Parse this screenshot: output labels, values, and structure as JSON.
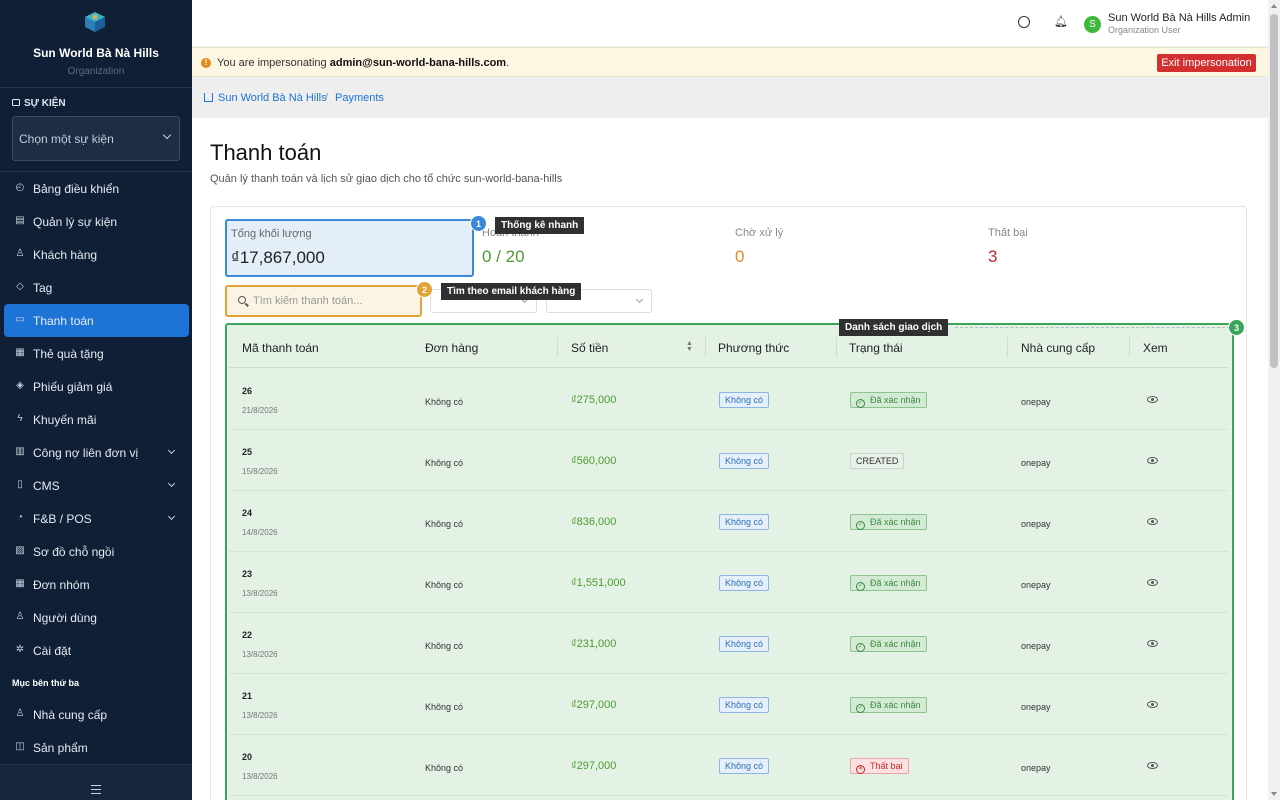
{
  "sidebar": {
    "brand_name": "Sun World Bà Nà Hills",
    "brand_sub": "Organization",
    "events_heading": "SỰ KIỆN",
    "event_select_placeholder": "Chọn một sự kiện",
    "items": [
      {
        "label": "Bảng điều khiển",
        "icon": "dashboard-icon"
      },
      {
        "label": "Quản lý sự kiện",
        "icon": "calendar-icon"
      },
      {
        "label": "Khách hàng",
        "icon": "users-icon"
      },
      {
        "label": "Tag",
        "icon": "tag-icon"
      },
      {
        "label": "Thanh toán",
        "icon": "credit-card-icon",
        "active": true
      },
      {
        "label": "Thẻ quà tặng",
        "icon": "gift-icon"
      },
      {
        "label": "Phiếu giảm giá",
        "icon": "coupon-icon"
      },
      {
        "label": "Khuyến mãi",
        "icon": "zap-icon"
      },
      {
        "label": "Công nợ liên đơn vị",
        "icon": "ledger-icon",
        "expandable": true
      },
      {
        "label": "CMS",
        "icon": "file-icon",
        "expandable": true
      },
      {
        "label": "F&B / POS",
        "icon": "coffee-icon",
        "expandable": true
      },
      {
        "label": "Sơ đồ chỗ ngồi",
        "icon": "seat-map-icon"
      },
      {
        "label": "Đơn nhóm",
        "icon": "grid-icon"
      },
      {
        "label": "Người dùng",
        "icon": "user-icon"
      },
      {
        "label": "Cài đặt",
        "icon": "settings-icon"
      }
    ],
    "third_party_heading": "Mục bên thứ ba",
    "third_party_items": [
      {
        "label": "Nhà cung cấp",
        "icon": "user-icon"
      },
      {
        "label": "Sản phẩm",
        "icon": "bag-icon"
      }
    ]
  },
  "topbar": {
    "user_name": "Sun World Bà Nà Hills Admin",
    "user_role": "Organization User",
    "avatar_letter": "S",
    "avatar_color": "#3db83a"
  },
  "banner": {
    "prefix": "You are impersonating ",
    "email": "admin@sun-world-bana-hills.com",
    "suffix": ".",
    "exit_label": "Exit impersonation"
  },
  "breadcrumb": {
    "home": "Sun World Bà Nà Hills",
    "current": "Payments"
  },
  "page": {
    "title": "Thanh toán",
    "subtitle": "Quản lý thanh toán và lịch sử giao dịch cho tổ chức sun-world-bana-hills"
  },
  "stats": [
    {
      "label": "Tổng khối lượng",
      "value": "₫17,867,000"
    },
    {
      "label": "Hoàn thành",
      "value": "0 / 20"
    },
    {
      "label": "Chờ xử lý",
      "value": "0"
    },
    {
      "label": "Thất bại",
      "value": "3"
    }
  ],
  "search": {
    "placeholder": "Tìm kiếm thanh toán..."
  },
  "annotations": [
    {
      "num": "1",
      "label": "Thống kê nhanh",
      "color": "#3b87d9"
    },
    {
      "num": "2",
      "label": "Tìm theo email khách hàng",
      "color": "#e0a437"
    },
    {
      "num": "3",
      "label": "Danh sách giao dịch",
      "color": "#3aa55a"
    }
  ],
  "table": {
    "headers": [
      "Mã thanh toán",
      "Đơn hàng",
      "Số tiền",
      "Phương thức",
      "Trạng thái",
      "Nhà cung cấp",
      "Xem"
    ],
    "rows": [
      {
        "id": "26",
        "date": "21/8/2026",
        "order": "Không có",
        "amount": "₫275,000",
        "method": "Không có",
        "status": "Đã xác nhận",
        "status_type": "ok",
        "provider": "onepay"
      },
      {
        "id": "25",
        "date": "15/8/2026",
        "order": "Không có",
        "amount": "₫560,000",
        "method": "Không có",
        "status": "CREATED",
        "status_type": "created",
        "provider": "onepay"
      },
      {
        "id": "24",
        "date": "14/8/2026",
        "order": "Không có",
        "amount": "₫836,000",
        "method": "Không có",
        "status": "Đã xác nhận",
        "status_type": "ok",
        "provider": "onepay"
      },
      {
        "id": "23",
        "date": "13/8/2026",
        "order": "Không có",
        "amount": "₫1,551,000",
        "method": "Không có",
        "status": "Đã xác nhận",
        "status_type": "ok",
        "provider": "onepay"
      },
      {
        "id": "22",
        "date": "13/8/2026",
        "order": "Không có",
        "amount": "₫231,000",
        "method": "Không có",
        "status": "Đã xác nhận",
        "status_type": "ok",
        "provider": "onepay"
      },
      {
        "id": "21",
        "date": "13/8/2026",
        "order": "Không có",
        "amount": "₫297,000",
        "method": "Không có",
        "status": "Đã xác nhận",
        "status_type": "ok",
        "provider": "onepay"
      },
      {
        "id": "20",
        "date": "13/8/2026",
        "order": "Không có",
        "amount": "₫297,000",
        "method": "Không có",
        "status": "Thất bại",
        "status_type": "fail",
        "provider": "onepay"
      }
    ]
  }
}
